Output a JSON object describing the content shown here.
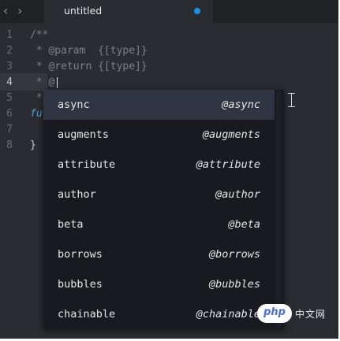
{
  "tab": {
    "title": "untitled",
    "dirty_color": "#1e8fe6",
    "back_icon": "chevron-left",
    "forward_icon": "chevron-right"
  },
  "editor": {
    "line_numbers": [
      "1",
      "2",
      "3",
      "4",
      "5",
      "6",
      "7",
      "8"
    ],
    "lines": {
      "l1": "/**",
      "l2": " * @param  {[type]}",
      "l3": " * @return {[type]}",
      "l4": " * @",
      "l5": " *",
      "l6": "fu",
      "l8": "}"
    },
    "active_line": "4"
  },
  "autocomplete": {
    "items": [
      {
        "label": "async",
        "hint": "@async",
        "selected": true
      },
      {
        "label": "augments",
        "hint": "@augments",
        "selected": false
      },
      {
        "label": "attribute",
        "hint": "@attribute",
        "selected": false
      },
      {
        "label": "author",
        "hint": "@author",
        "selected": false
      },
      {
        "label": "beta",
        "hint": "@beta",
        "selected": false
      },
      {
        "label": "borrows",
        "hint": "@borrows",
        "selected": false
      },
      {
        "label": "bubbles",
        "hint": "@bubbles",
        "selected": false
      },
      {
        "label": "chainable",
        "hint": "@chainable",
        "selected": false
      }
    ]
  },
  "watermark": {
    "badge": "php",
    "text": "中文网"
  }
}
